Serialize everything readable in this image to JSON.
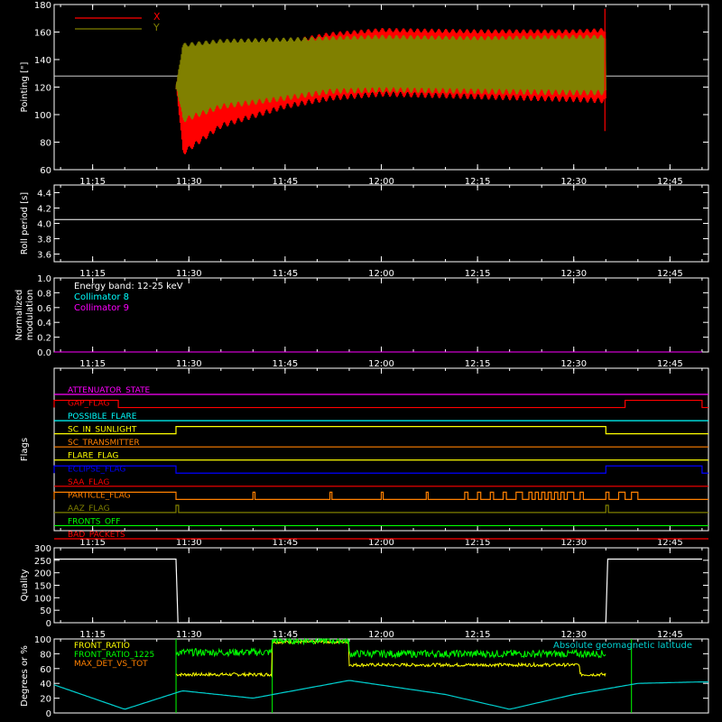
{
  "chart_data": [
    {
      "type": "line",
      "ylabel": "Pointing [\"]",
      "ylim": [
        60,
        180
      ],
      "yticks": [
        60,
        80,
        100,
        120,
        140,
        160,
        180
      ],
      "xticks": [
        "11:15",
        "11:30",
        "11:45",
        "12:00",
        "12:15",
        "12:30",
        "12:45"
      ],
      "reference_line": 128,
      "series": [
        {
          "name": "X",
          "color": "#ff0000",
          "x_start": "11:28",
          "x_end": "12:35",
          "upper_envelope": [
            {
              "t": "11:28",
              "v": 120
            },
            {
              "t": "11:29",
              "v": 146
            },
            {
              "t": "11:35",
              "v": 150
            },
            {
              "t": "11:45",
              "v": 154
            },
            {
              "t": "11:52",
              "v": 160
            },
            {
              "t": "12:00",
              "v": 163
            },
            {
              "t": "12:15",
              "v": 162
            },
            {
              "t": "12:30",
              "v": 162
            },
            {
              "t": "12:35",
              "v": 163
            }
          ],
          "lower_envelope": [
            {
              "t": "11:28",
              "v": 120
            },
            {
              "t": "11:29",
              "v": 70
            },
            {
              "t": "11:35",
              "v": 90
            },
            {
              "t": "11:45",
              "v": 104
            },
            {
              "t": "11:52",
              "v": 110
            },
            {
              "t": "12:00",
              "v": 113
            },
            {
              "t": "12:15",
              "v": 111
            },
            {
              "t": "12:30",
              "v": 109
            },
            {
              "t": "12:35",
              "v": 108
            }
          ]
        },
        {
          "name": "Y",
          "color": "#808000",
          "x_start": "11:28",
          "x_end": "12:35",
          "upper_envelope": [
            {
              "t": "11:28",
              "v": 120
            },
            {
              "t": "11:29",
              "v": 152
            },
            {
              "t": "11:35",
              "v": 155
            },
            {
              "t": "11:45",
              "v": 156
            },
            {
              "t": "11:52",
              "v": 157
            },
            {
              "t": "12:00",
              "v": 158
            },
            {
              "t": "12:15",
              "v": 157
            },
            {
              "t": "12:30",
              "v": 158
            },
            {
              "t": "12:35",
              "v": 158
            }
          ],
          "lower_envelope": [
            {
              "t": "11:28",
              "v": 120
            },
            {
              "t": "11:29",
              "v": 94
            },
            {
              "t": "11:35",
              "v": 104
            },
            {
              "t": "11:45",
              "v": 110
            },
            {
              "t": "11:52",
              "v": 115
            },
            {
              "t": "12:00",
              "v": 116
            },
            {
              "t": "12:15",
              "v": 115
            },
            {
              "t": "12:30",
              "v": 114
            },
            {
              "t": "12:35",
              "v": 114
            }
          ]
        }
      ]
    },
    {
      "type": "line",
      "ylabel": "Roll period [s]",
      "ylim": [
        3.5,
        4.5
      ],
      "yticks": [
        "3.6",
        "3.8",
        "4.0",
        "4.2",
        "4.4"
      ],
      "xticks": [
        "11:15",
        "11:30",
        "11:45",
        "12:00",
        "12:15",
        "12:30",
        "12:45"
      ],
      "series": [
        {
          "color": "#ffffff",
          "values": [
            {
              "t": "11:09",
              "v": 4.05
            },
            {
              "t": "12:50",
              "v": 4.05
            }
          ]
        }
      ]
    },
    {
      "type": "line",
      "ylabel": "Normalized modulation",
      "ylim": [
        0.0,
        1.0
      ],
      "yticks": [
        "0.0",
        "0.2",
        "0.4",
        "0.6",
        "0.8",
        "1.0"
      ],
      "xticks": [
        "11:15",
        "11:30",
        "11:45",
        "12:00",
        "12:15",
        "12:30",
        "12:45"
      ],
      "energy_band": "Energy band: 12-25 keV",
      "series": [
        {
          "name": "Collimator 8",
          "color": "#00ffff",
          "values": [
            {
              "t": "11:09",
              "v": 0.0
            },
            {
              "t": "12:50",
              "v": 0.0
            }
          ]
        },
        {
          "name": "Collimator 9",
          "color": "#ff00ff",
          "values": [
            {
              "t": "11:09",
              "v": 0.0
            },
            {
              "t": "12:50",
              "v": 0.0
            }
          ]
        }
      ]
    },
    {
      "type": "line",
      "ylabel": "Flags",
      "xticks": [
        "11:15",
        "11:30",
        "11:45",
        "12:00",
        "12:15",
        "12:30",
        "12:45"
      ],
      "flags": [
        {
          "name": "ATTENUATOR_STATE",
          "color": "#ff00ff",
          "high": []
        },
        {
          "name": "GAP_FLAG",
          "color": "#ff0000",
          "high": [
            [
              "11:09",
              "11:19"
            ],
            [
              "12:38",
              "12:50"
            ]
          ]
        },
        {
          "name": "POSSIBLE_FLARE",
          "color": "#00ffff",
          "high": []
        },
        {
          "name": "SC_IN_SUNLIGHT",
          "color": "#ffff00",
          "high": [
            [
              "11:28",
              "12:35"
            ]
          ]
        },
        {
          "name": "SC_TRANSMITTER",
          "color": "#ff8000",
          "high": []
        },
        {
          "name": "FLARE_FLAG",
          "color": "#ffff00",
          "high": []
        },
        {
          "name": "ECLIPSE_FLAG",
          "color": "#0000ff",
          "high": [
            [
              "11:09",
              "11:28"
            ],
            [
              "12:35",
              "12:50"
            ]
          ]
        },
        {
          "name": "SAA_FLAG",
          "color": "#ff0000",
          "high": []
        },
        {
          "name": "PARTICLE_FLAG",
          "color": "#ff8000",
          "high": [
            [
              "11:09",
              "11:28"
            ],
            [
              "11:40",
              "11:40.3"
            ],
            [
              "11:52",
              "11:52.3"
            ],
            [
              "12:00",
              "12:00.3"
            ],
            [
              "12:07",
              "12:07.3"
            ],
            [
              "12:13",
              "12:13.5"
            ],
            [
              "12:15",
              "12:15.5"
            ],
            [
              "12:17",
              "12:17.5"
            ],
            [
              "12:19",
              "12:19.5"
            ],
            [
              "12:21",
              "12:22"
            ],
            [
              "12:23",
              "12:23.5"
            ],
            [
              "12:24",
              "12:24.5"
            ],
            [
              "12:25",
              "12:25.5"
            ],
            [
              "12:26",
              "12:26.5"
            ],
            [
              "12:27",
              "12:27.5"
            ],
            [
              "12:28",
              "12:28.5"
            ],
            [
              "12:29",
              "12:30"
            ],
            [
              "12:31",
              "12:31.5"
            ],
            [
              "12:35",
              "12:35.5"
            ],
            [
              "12:37",
              "12:38"
            ],
            [
              "12:39",
              "12:40"
            ]
          ]
        },
        {
          "name": "AAZ_FLAG",
          "color": "#808000",
          "high": [
            [
              "11:28",
              "11:28.4"
            ],
            [
              "12:35",
              "12:35.4"
            ]
          ]
        },
        {
          "name": "FRONTS_OFF",
          "color": "#00ff00",
          "high": []
        },
        {
          "name": "BAD_PACKETS",
          "color": "#ff0000",
          "high": []
        }
      ]
    },
    {
      "type": "line",
      "ylabel": "Quality",
      "ylim": [
        0,
        300
      ],
      "yticks": [
        0,
        50,
        100,
        150,
        200,
        250,
        300
      ],
      "xticks": [
        "11:15",
        "11:30",
        "11:45",
        "12:00",
        "12:15",
        "12:30",
        "12:45"
      ],
      "series": [
        {
          "color": "#ffffff",
          "values": [
            {
              "t": "11:09",
              "v": 255
            },
            {
              "t": "11:28",
              "v": 255
            },
            {
              "t": "11:28.3",
              "v": 0
            },
            {
              "t": "12:35",
              "v": 0
            },
            {
              "t": "12:35.3",
              "v": 255
            },
            {
              "t": "12:50",
              "v": 255
            }
          ]
        }
      ]
    },
    {
      "type": "line",
      "ylabel": "Degrees or %",
      "ylim": [
        0,
        100
      ],
      "yticks": [
        0,
        20,
        40,
        60,
        80,
        100
      ],
      "series": [
        {
          "name": "FRONT_RATIO",
          "color": "#ffff00",
          "segments": [
            {
              "from": "11:28",
              "to": "11:43",
              "level": 52
            },
            {
              "from": "11:43",
              "to": "11:55",
              "level": 96
            },
            {
              "from": "11:55",
              "to": "12:31",
              "level": 65
            },
            {
              "from": "12:31",
              "to": "12:35",
              "level": 52
            }
          ]
        },
        {
          "name": "FRONT_RATIO_1225",
          "color": "#00ff00",
          "segments": [
            {
              "from": "11:28",
              "to": "11:43",
              "level": 82
            },
            {
              "from": "11:43",
              "to": "11:55",
              "level": 98
            },
            {
              "from": "11:55",
              "to": "12:35",
              "level": 80
            }
          ]
        },
        {
          "name": "MAX_DET_VS_TOT",
          "color": "#ff8000",
          "segments": []
        },
        {
          "name": "Absolute geomagnetic latitude",
          "color": "#00d0d0",
          "values": [
            {
              "t": "11:09",
              "v": 38
            },
            {
              "t": "11:20",
              "v": 5
            },
            {
              "t": "11:29",
              "v": 30
            },
            {
              "t": "11:40",
              "v": 20
            },
            {
              "t": "11:55",
              "v": 44
            },
            {
              "t": "12:10",
              "v": 25
            },
            {
              "t": "12:20",
              "v": 5
            },
            {
              "t": "12:30",
              "v": 25
            },
            {
              "t": "12:40",
              "v": 40
            },
            {
              "t": "12:50",
              "v": 42
            }
          ]
        }
      ],
      "vertical_markers": [
        {
          "t": "11:28",
          "color": "#00ff00"
        },
        {
          "t": "11:43",
          "color": "#00ff00"
        },
        {
          "t": "12:39",
          "color": "#00ff00"
        }
      ]
    }
  ]
}
